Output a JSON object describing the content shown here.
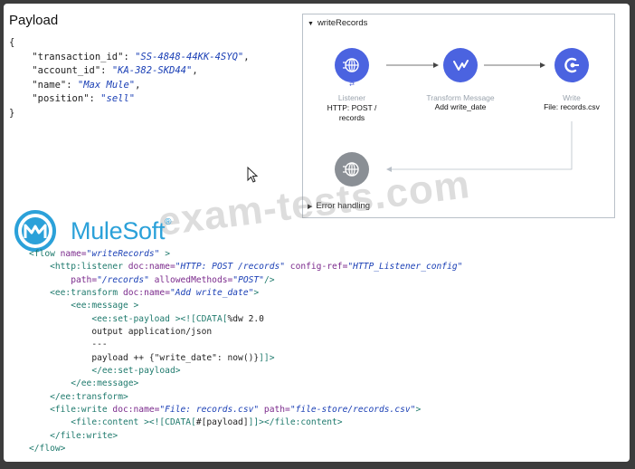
{
  "payload": {
    "title": "Payload",
    "open_brace": "{",
    "close_brace": "}",
    "fields": [
      {
        "key": "\"transaction_id\"",
        "value": "\"SS-4848-44KK-4SYQ\"",
        "sep": ": ",
        "comma": ","
      },
      {
        "key": "\"account_id\"",
        "value": "\"KA-382-SKD44\"",
        "sep": ": ",
        "comma": ","
      },
      {
        "key": "\"name\"",
        "value": "\"Max Mule\"",
        "sep": ": ",
        "comma": ","
      },
      {
        "key": "\"position\"",
        "value": "\"sell\"",
        "sep": ": ",
        "comma": ""
      }
    ]
  },
  "flow": {
    "name": "writeRecords",
    "error_handling": "Error handling",
    "nodes": [
      {
        "type": "Listener",
        "label": "HTTP: POST / records",
        "icon": "globe-icon",
        "color": "#4b63e0"
      },
      {
        "type": "Transform Message",
        "label": "Add write_date",
        "icon": "transform-icon",
        "color": "#4b63e0"
      },
      {
        "type": "Write",
        "label": "File: records.csv",
        "icon": "file-connector-icon",
        "color": "#4b63e0"
      },
      {
        "type": "",
        "label": "",
        "icon": "globe-icon",
        "color": "#8a8f95"
      }
    ]
  },
  "logo": {
    "text": "MuleSoft",
    "mark": "®"
  },
  "watermark": "exam-tests.com",
  "code": {
    "l1": {
      "open": "<flow ",
      "a1": "name=",
      "v1": "\"writeRecords\"",
      "close": " >"
    },
    "l2": {
      "open": "<http:listener ",
      "a1": "doc:name=",
      "v1": "\"HTTP: POST /records\"",
      "a2": " config-ref=",
      "v2": "\"HTTP_Listener_config\""
    },
    "l3": {
      "a1": "path=",
      "v1": "\"/records\"",
      "a2": " allowedMethods=",
      "v2": "\"POST\"",
      "close": "/>"
    },
    "l4": {
      "open": "<ee:transform ",
      "a1": "doc:name=",
      "v1": "\"Add write_date\"",
      "close": ">"
    },
    "l5": {
      "open": "<ee:message >"
    },
    "l6": {
      "open": "<ee:set-payload >",
      "cdata": "<![CDATA[",
      "text": "%dw 2.0"
    },
    "l7": {
      "text": "output application/json"
    },
    "l8": {
      "text": "---"
    },
    "l9": {
      "text": "payload ++ {\"write_date\": now()}",
      "cdata_end": "]]>"
    },
    "l10": {
      "close": "</ee:set-payload>"
    },
    "l11": {
      "close": "</ee:message>"
    },
    "l12": {
      "close": "</ee:transform>"
    },
    "l13": {
      "open": "<file:write ",
      "a1": "doc:name=",
      "v1": "\"File: records.csv\"",
      "a2": " path=",
      "v2": "\"file-store/records.csv\"",
      "close": ">"
    },
    "l14": {
      "open": "<file:content >",
      "cdata": "<![CDATA[",
      "text": "#[payload]",
      "cdata_end": "]]>",
      "close": "</file:content>"
    },
    "l15": {
      "close": "</file:write>"
    },
    "l16": {
      "close": "</flow>"
    }
  }
}
